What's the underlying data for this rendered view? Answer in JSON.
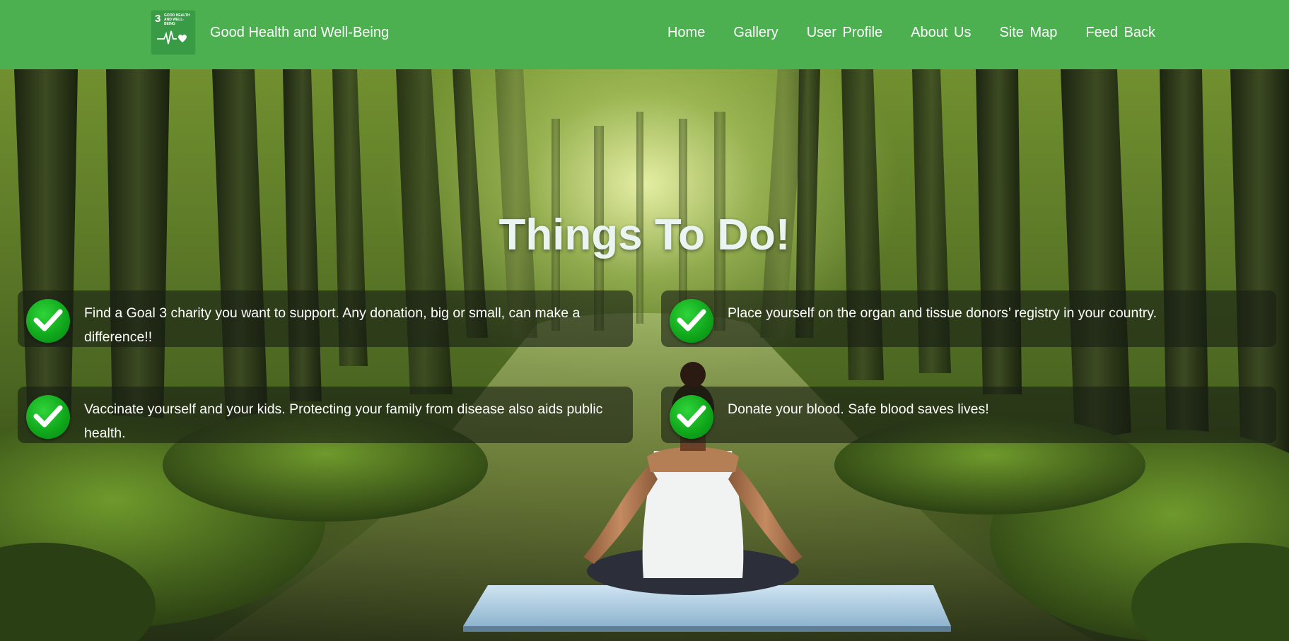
{
  "header": {
    "logo": {
      "number": "3",
      "text": "GOOD HEALTH AND WELL-BEING",
      "icon": "heartbeat-heart-icon"
    },
    "site_title": "Good Health and Well-Being",
    "nav": [
      {
        "label": "Home"
      },
      {
        "label": "Gallery"
      },
      {
        "label": "User  Profile"
      },
      {
        "label": "About  Us"
      },
      {
        "label": "Site  Map"
      },
      {
        "label": "Feed  Back"
      }
    ]
  },
  "hero": {
    "background": "forest-river-meditation-photo",
    "heading": "Things To Do!",
    "items": [
      {
        "icon": "checkmark-icon",
        "text": "Find a Goal 3 charity you want to support. Any donation, big or small, can make a difference!!"
      },
      {
        "icon": "checkmark-icon",
        "text": "Place yourself on the organ and tissue donors’ registry in your country."
      },
      {
        "icon": "checkmark-icon",
        "text": "Vaccinate yourself and your kids. Protecting your family from disease also aids public health."
      },
      {
        "icon": "checkmark-icon",
        "text": "Donate your blood. Safe blood saves lives!"
      }
    ]
  },
  "colors": {
    "nav_bg": "#4caf50",
    "logo_bg": "#3a9b46",
    "check_green": "#12b01f",
    "card_bg": "rgba(25,30,20,0.62)"
  }
}
